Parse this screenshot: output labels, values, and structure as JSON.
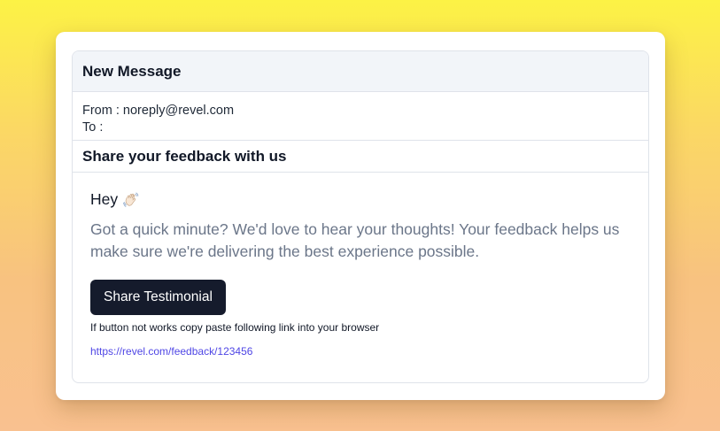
{
  "window": {
    "title": "New Message"
  },
  "email": {
    "from_label": "From : ",
    "from_value": "noreply@revel.com",
    "to_label": "To : ",
    "to_value": "",
    "subject": "Share your feedback with us",
    "greeting": "Hey",
    "greeting_icon": "waving-hand-icon",
    "message": "Got a quick minute? We'd love to hear your thoughts! Your feedback helps us make sure we're delivering the best experience possible.",
    "cta_label": "Share Testimonial",
    "fallback_hint": "If button not works copy paste following link into your browser",
    "fallback_link": "https://revel.com/feedback/123456"
  },
  "colors": {
    "cta_background": "#151b2c",
    "link": "#4f46e5",
    "body_text": "#6b7689",
    "header_background": "#f2f5f9"
  }
}
